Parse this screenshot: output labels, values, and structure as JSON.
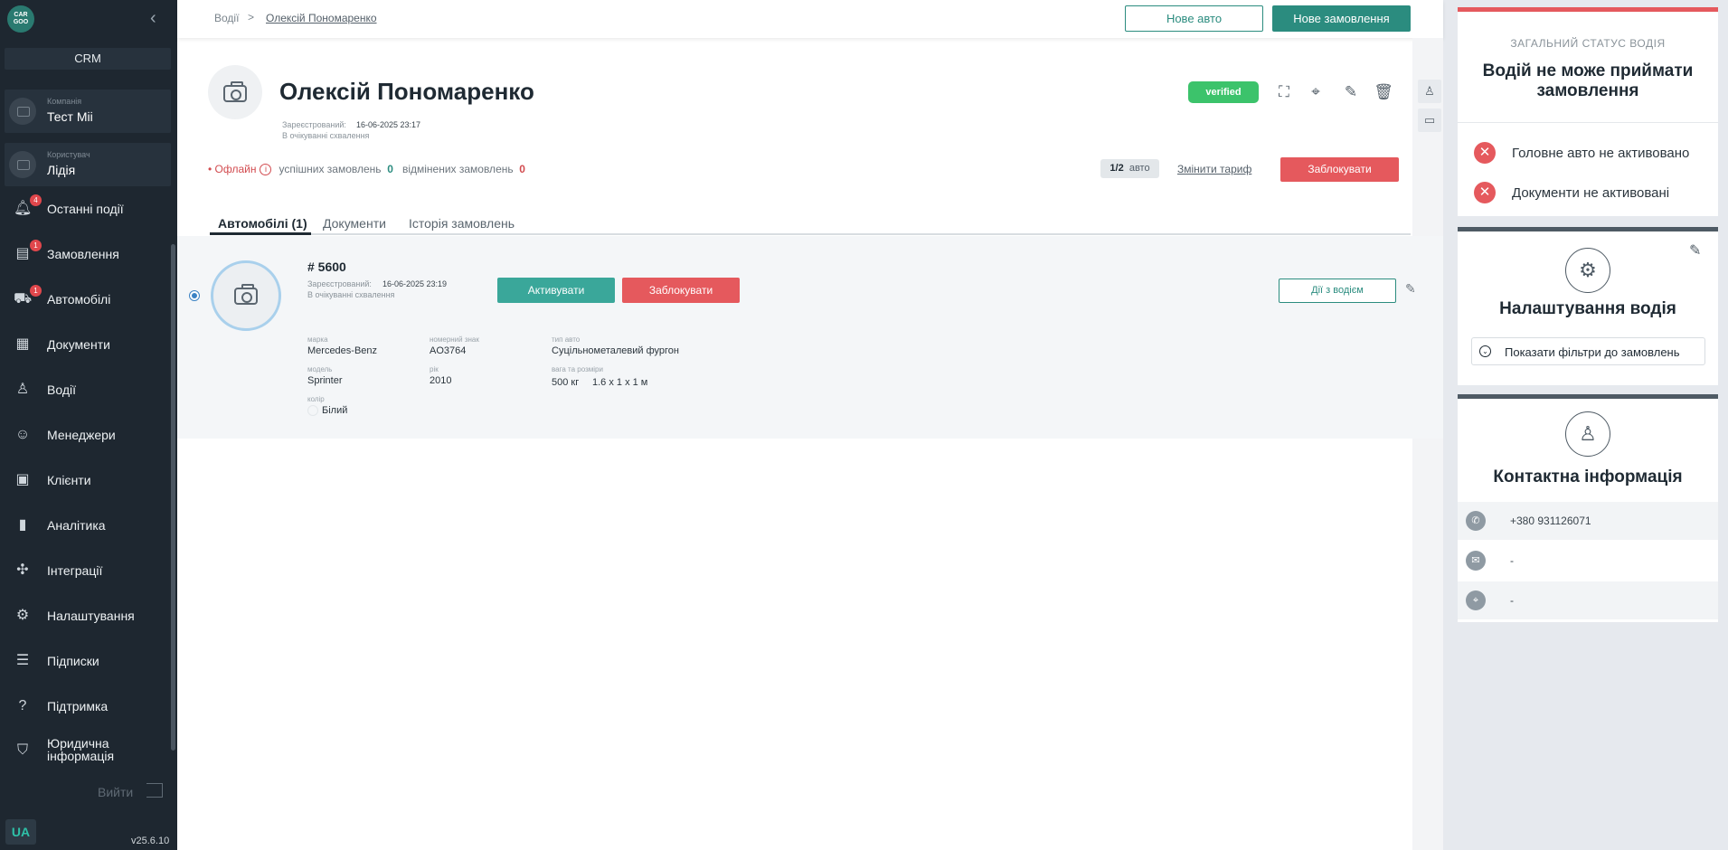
{
  "sidebar": {
    "logo_text": "CAR GOO",
    "crm_label": "CRM",
    "company": {
      "label": "Компанія",
      "value": "Тест Міі"
    },
    "user": {
      "label": "Користувач",
      "value": "Лідія"
    },
    "items": [
      {
        "label": "Останні події",
        "icon": "bell-icon",
        "badge": "4"
      },
      {
        "label": "Замовлення",
        "icon": "clipboard-icon",
        "badge": "1"
      },
      {
        "label": "Автомобілі",
        "icon": "truck-icon",
        "badge": "1"
      },
      {
        "label": "Документи",
        "icon": "document-icon",
        "badge": ""
      },
      {
        "label": "Водії",
        "icon": "driver-icon",
        "badge": ""
      },
      {
        "label": "Менеджери",
        "icon": "manager-icon",
        "badge": ""
      },
      {
        "label": "Клієнти",
        "icon": "clients-icon",
        "badge": ""
      },
      {
        "label": "Аналітика",
        "icon": "analytics-icon",
        "badge": ""
      },
      {
        "label": "Інтеграції",
        "icon": "integrations-icon",
        "badge": ""
      },
      {
        "label": "Налаштування",
        "icon": "gear-icon",
        "badge": ""
      },
      {
        "label": "Підписки",
        "icon": "subscriptions-icon",
        "badge": ""
      },
      {
        "label": "Підтримка",
        "icon": "help-icon",
        "badge": ""
      },
      {
        "label": "Юридична інформація",
        "icon": "shield-icon",
        "badge": ""
      }
    ],
    "logout": "Вийти",
    "lang": "UA",
    "version": "v25.6.10"
  },
  "breadcrumb": {
    "root": "Водії",
    "sep": ">",
    "current": "Олексій Пономаренко"
  },
  "topbar": {
    "new_car": "Нове авто",
    "new_order": "Нове замовлення"
  },
  "driver": {
    "name": "Олексій Пономаренко",
    "registered_label": "Зареєстрований:",
    "registered_value": "16-06-2025 23:17",
    "approval_status": "В очікуванні схвалення",
    "verified_badge": "verified",
    "online_status": "• Офлайн",
    "success_label": "успішних замовлень",
    "success_count": "0",
    "cancelled_label": "відмінених замовлень",
    "cancelled_count": "0",
    "auto_quota": "1/2",
    "auto_word": "авто",
    "change_tariff": "Змінити тариф",
    "block": "Заблокувати"
  },
  "tabs": [
    {
      "label": "Автомобілі (1)",
      "active": true
    },
    {
      "label": "Документи",
      "active": false
    },
    {
      "label": "Історія замовлень",
      "active": false
    }
  ],
  "car": {
    "number": "# 5600",
    "registered_label": "Зареєстрований:",
    "registered_value": "16-06-2025 23:19",
    "approval_status": "В очікуванні схвалення",
    "activate": "Активувати",
    "block": "Заблокувати",
    "driver_actions": "Дії з водієм",
    "fields": {
      "brand_label": "марка",
      "brand": "Mercedes-Benz",
      "plate_label": "номерний знак",
      "plate": "AO3764",
      "type_label": "тип авто",
      "type": "Суцільнометалевий фургон",
      "model_label": "модель",
      "model": "Sprinter",
      "year_label": "рік",
      "year": "2010",
      "weight_label": "вага та розміри",
      "weight": "500 кг",
      "dims": "1.6 x 1 x 1 м",
      "color_label": "колір",
      "color": "Білий"
    }
  },
  "status_panel": {
    "kicker": "ЗАГАЛЬНИЙ СТАТУС ВОДІЯ",
    "title": "Водій не може приймати замовлення",
    "errors": [
      "Головне авто не активовано",
      "Документи не активовані"
    ]
  },
  "settings_panel": {
    "title": "Налаштування водія",
    "filters": "Показати фільтри до замовлень"
  },
  "contact_panel": {
    "title": "Контактна інформація",
    "phone": "+380 931126071",
    "email": "-",
    "address": "-"
  },
  "colors": {
    "accent": "#2b8c7f",
    "danger": "#e5595d",
    "verified": "#3cc36b",
    "sidebar": "#1e2730"
  }
}
